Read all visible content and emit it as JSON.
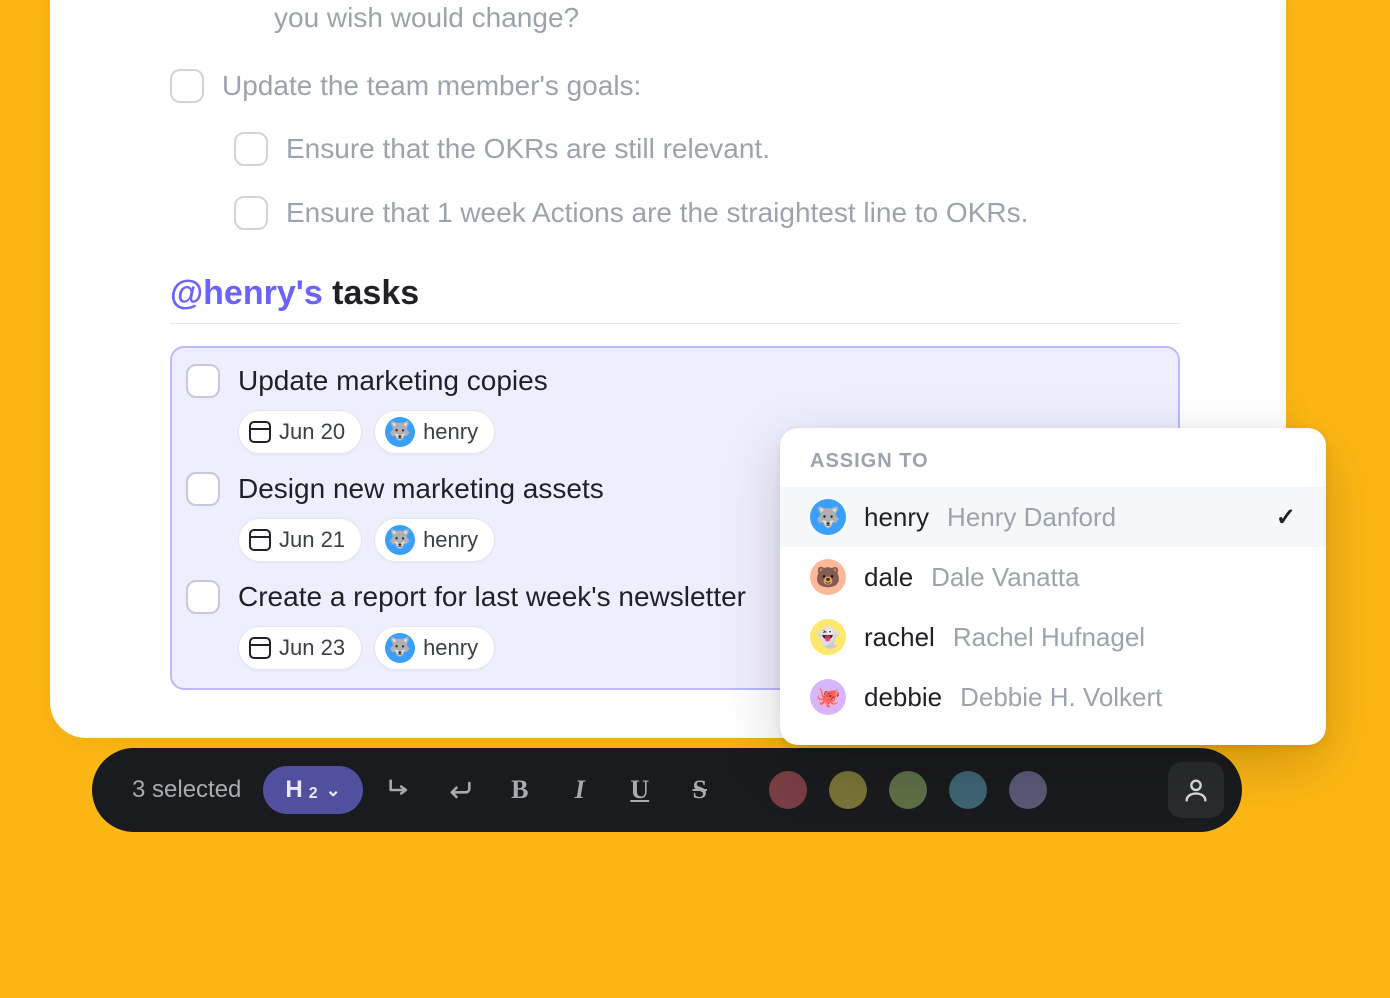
{
  "top": {
    "prev_line": "you wish would change?",
    "items": [
      {
        "label": "Update the team member's goals:",
        "indent": false
      },
      {
        "label": "Ensure that the OKRs are still relevant.",
        "indent": true
      },
      {
        "label": "Ensure that 1 week Actions are the straightest line to OKRs.",
        "indent": true
      }
    ]
  },
  "section": {
    "mention": "@henry's",
    "suffix": " tasks"
  },
  "tasks": [
    {
      "title": "Update marketing copies",
      "date": "Jun 20",
      "assignee": "henry"
    },
    {
      "title": "Design new marketing assets",
      "date": "Jun 21",
      "assignee": "henry"
    },
    {
      "title": "Create a report for last week's newsletter",
      "date": "Jun 23",
      "assignee": "henry"
    }
  ],
  "popover": {
    "title": "ASSIGN TO",
    "people": [
      {
        "username": "henry",
        "fullname": "Henry Danford",
        "avatar": "blue",
        "emoji": "🐺",
        "selected": true
      },
      {
        "username": "dale",
        "fullname": "Dale Vanatta",
        "avatar": "peach",
        "emoji": "🐻",
        "selected": false
      },
      {
        "username": "rachel",
        "fullname": "Rachel Hufnagel",
        "avatar": "yellow",
        "emoji": "👻",
        "selected": false
      },
      {
        "username": "debbie",
        "fullname": "Debbie H. Volkert",
        "avatar": "pink",
        "emoji": "🐙",
        "selected": false
      }
    ]
  },
  "toolbar": {
    "selected_label": "3 selected",
    "heading": {
      "label": "H",
      "sub": "2"
    },
    "styles": {
      "bold": "B",
      "italic": "I",
      "underline": "U",
      "strike": "S"
    },
    "colors": [
      "#7a3e44",
      "#7a7438",
      "#5e7046",
      "#3f6472",
      "#5b5876"
    ]
  }
}
